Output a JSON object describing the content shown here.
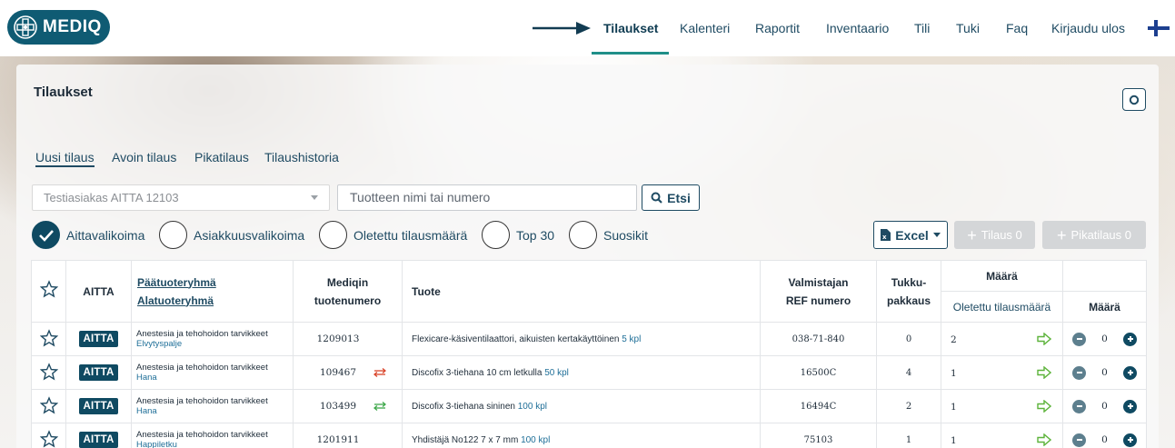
{
  "header": {
    "logo_text": "MEDIQ",
    "nav": [
      {
        "label": "Tilaukset",
        "active": true
      },
      {
        "label": "Kalenteri"
      },
      {
        "label": "Raportit"
      },
      {
        "label": "Inventaario"
      },
      {
        "label": "Tili"
      },
      {
        "label": "Tuki"
      },
      {
        "label": "Faq"
      },
      {
        "label": "Kirjaudu ulos"
      }
    ],
    "accent": "#1f8f88",
    "brand": "#0f5b73"
  },
  "page": {
    "title": "Tilaukset",
    "tabs": [
      {
        "label": "Uusi tilaus",
        "active": true
      },
      {
        "label": "Avoin tilaus"
      },
      {
        "label": "Pikatilaus"
      },
      {
        "label": "Tilaushistoria"
      }
    ],
    "customer_select": "Testiasiakas AITTA 12103",
    "search_placeholder": "Tuotteen nimi tai numero",
    "search_button": "Etsi",
    "filters": [
      {
        "label": "Aittavalikoima",
        "checked": true
      },
      {
        "label": "Asiakkuusvalikoima",
        "checked": false
      },
      {
        "label": "Oletettu tilausmäärä",
        "checked": false
      },
      {
        "label": "Top 30",
        "checked": false
      },
      {
        "label": "Suosikit",
        "checked": false
      }
    ],
    "excel_button": "Excel",
    "order_button": "Tilaus 0",
    "quick_order_button": "Pikatilaus 0"
  },
  "table": {
    "headers": {
      "aitta": "AITTA",
      "main_group": "Päätuoteryhmä",
      "sub_group": "Alatuoteryhmä",
      "product_number_1": "Mediqin",
      "product_number_2": "tuotenumero",
      "product": "Tuote",
      "ref_1": "Valmistajan",
      "ref_2": "REF numero",
      "pack_1": "Tukku-",
      "pack_2": "pakkaus",
      "quantity": "Määrä",
      "default_qty": "Oletettu tilausmäärä",
      "qty": "Määrä"
    },
    "rows": [
      {
        "badge": "AITTA",
        "main_group": "Anestesia ja tehohoidon tarvikkeet",
        "sub_group": "Elvytyspalje",
        "number": "1209013",
        "swap": null,
        "product": "Flexicare-käsiventilaattori, aikuisten kertakäyttöinen",
        "pack": "5 kpl",
        "ref": "038-71-840",
        "wholesale": "0",
        "default_qty": "2",
        "qty": "0"
      },
      {
        "badge": "AITTA",
        "main_group": "Anestesia ja tehohoidon tarvikkeet",
        "sub_group": "Hana",
        "number": "109467",
        "swap": "red",
        "product": "Discofix 3-tiehana 10 cm letkulla",
        "pack": "50 kpl",
        "ref": "16500C",
        "wholesale": "4",
        "default_qty": "1",
        "qty": "0"
      },
      {
        "badge": "AITTA",
        "main_group": "Anestesia ja tehohoidon tarvikkeet",
        "sub_group": "Hana",
        "number": "103499",
        "swap": "green",
        "product": "Discofix 3-tiehana sininen",
        "pack": "100 kpl",
        "ref": "16494C",
        "wholesale": "2",
        "default_qty": "1",
        "qty": "0"
      },
      {
        "badge": "AITTA",
        "main_group": "Anestesia ja tehohoidon tarvikkeet",
        "sub_group": "Happiletku",
        "number": "1201911",
        "swap": null,
        "product": "Yhdistäjä No122 7 x 7 mm",
        "pack": "100 kpl",
        "ref": "75103",
        "wholesale": "1",
        "default_qty": "1",
        "qty": "0"
      }
    ]
  }
}
